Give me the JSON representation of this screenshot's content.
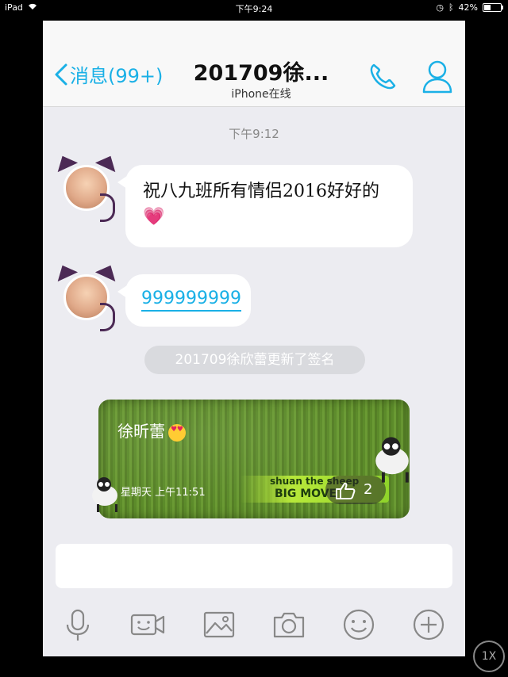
{
  "status_bar": {
    "device": "iPad",
    "time": "下午9:24",
    "battery": "42%"
  },
  "nav": {
    "back_label": "消息(99+)",
    "title": "201709徐...",
    "subtitle": "iPhone在线"
  },
  "chat": {
    "timestamp": "下午9:12",
    "messages": [
      {
        "text": "祝八九班所有情侣2016好好的💗"
      },
      {
        "text": "999999999"
      }
    ],
    "system_notice": "201709徐欣蕾更新了签名",
    "signature_card": {
      "name": "徐昕蕾",
      "date": "星期天 上午11:51",
      "banner_line1": "shuan the sheep",
      "banner_line2": "BIG MOVE",
      "like_count": "2"
    }
  },
  "input": {
    "placeholder": ""
  },
  "toolbar_icons": [
    "mic-icon",
    "video-icon",
    "image-icon",
    "camera-icon",
    "emoji-icon",
    "plus-icon"
  ],
  "zoom_badge": "1X",
  "colors": {
    "accent": "#1ab0e6",
    "background": "#ececf1",
    "grass": "#5c8b2a"
  }
}
